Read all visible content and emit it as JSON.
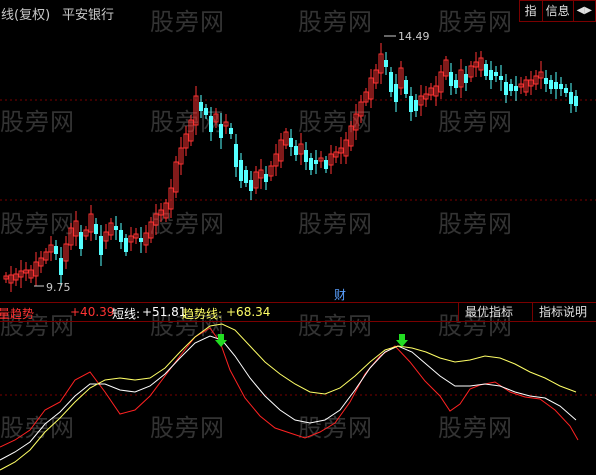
{
  "header": {
    "title_label": "日线(复权)",
    "stock_name": "平安银行"
  },
  "top_buttons": [
    {
      "label": "指"
    },
    {
      "label": "信息"
    },
    {
      "label": "◀▶"
    }
  ],
  "price_annotations": {
    "high": "14.49",
    "low": "9.75"
  },
  "finance_marker": "财",
  "indicator": {
    "name_value": "+40.39",
    "name_label": "能量趋势",
    "short_label": "短线:",
    "short_value": "+51.81",
    "trend_label": "趋势线:",
    "trend_value": "+68.34"
  },
  "sub_buttons": {
    "best": "最优指标",
    "help": "指标说明"
  },
  "watermark_text": "股旁网",
  "colors": {
    "up": "#ff3333",
    "down": "#54ffff",
    "grid": "#7a0000",
    "short_line": "#ffffff",
    "trend_line": "#ffff66",
    "energy_line": "#ff2222",
    "arrow": "#22dd22"
  },
  "chart_data": {
    "type": "candlestick",
    "high_label": 14.49,
    "low_label": 9.75
  }
}
